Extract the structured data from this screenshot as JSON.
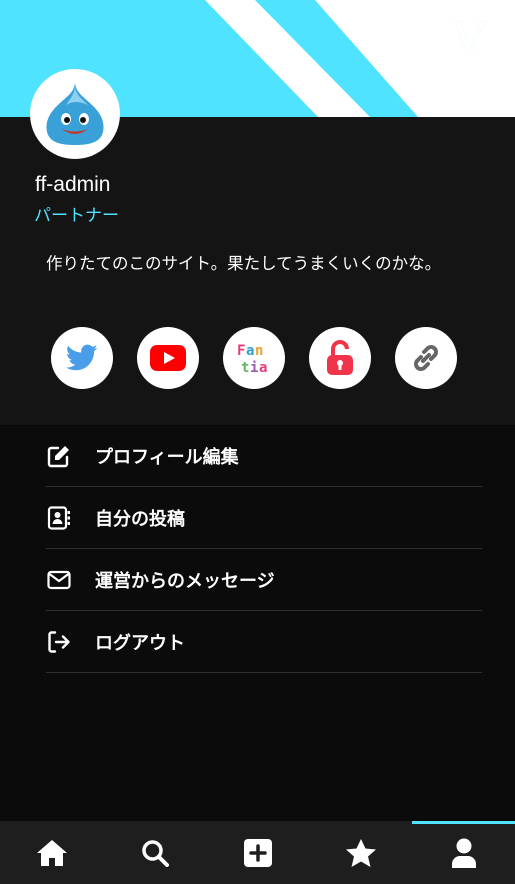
{
  "app": {
    "logo_text": "V"
  },
  "profile": {
    "username": "ff-admin",
    "role": "パートナー",
    "bio": "作りたてのこのサイト。果たしてうまくいくのかな。"
  },
  "socials": [
    {
      "name": "twitter",
      "icon": "twitter-bird-icon",
      "color": "#4a9ee8"
    },
    {
      "name": "youtube",
      "icon": "youtube-play-icon",
      "color": "#ff0000"
    },
    {
      "name": "fantia",
      "icon": "fantia-logo-icon"
    },
    {
      "name": "unlock",
      "icon": "unlock-icon",
      "color": "#f0354a"
    },
    {
      "name": "link",
      "icon": "chain-link-icon",
      "color": "#666666"
    }
  ],
  "menu": {
    "items": [
      {
        "label": "プロフィール編集",
        "icon": "edit-icon"
      },
      {
        "label": "自分の投稿",
        "icon": "contact-book-icon"
      },
      {
        "label": "運営からのメッセージ",
        "icon": "envelope-icon"
      },
      {
        "label": "ログアウト",
        "icon": "logout-icon"
      }
    ]
  },
  "tabbar": {
    "items": [
      {
        "name": "home",
        "icon": "home-icon"
      },
      {
        "name": "search",
        "icon": "search-icon"
      },
      {
        "name": "post",
        "icon": "plus-square-icon"
      },
      {
        "name": "favorites",
        "icon": "star-icon"
      },
      {
        "name": "profile",
        "icon": "user-icon",
        "active": true
      }
    ]
  },
  "colors": {
    "accent": "#4fe3ff",
    "background": "#0b0b0b",
    "card": "#141414",
    "tabbar": "#1e1e1e"
  }
}
